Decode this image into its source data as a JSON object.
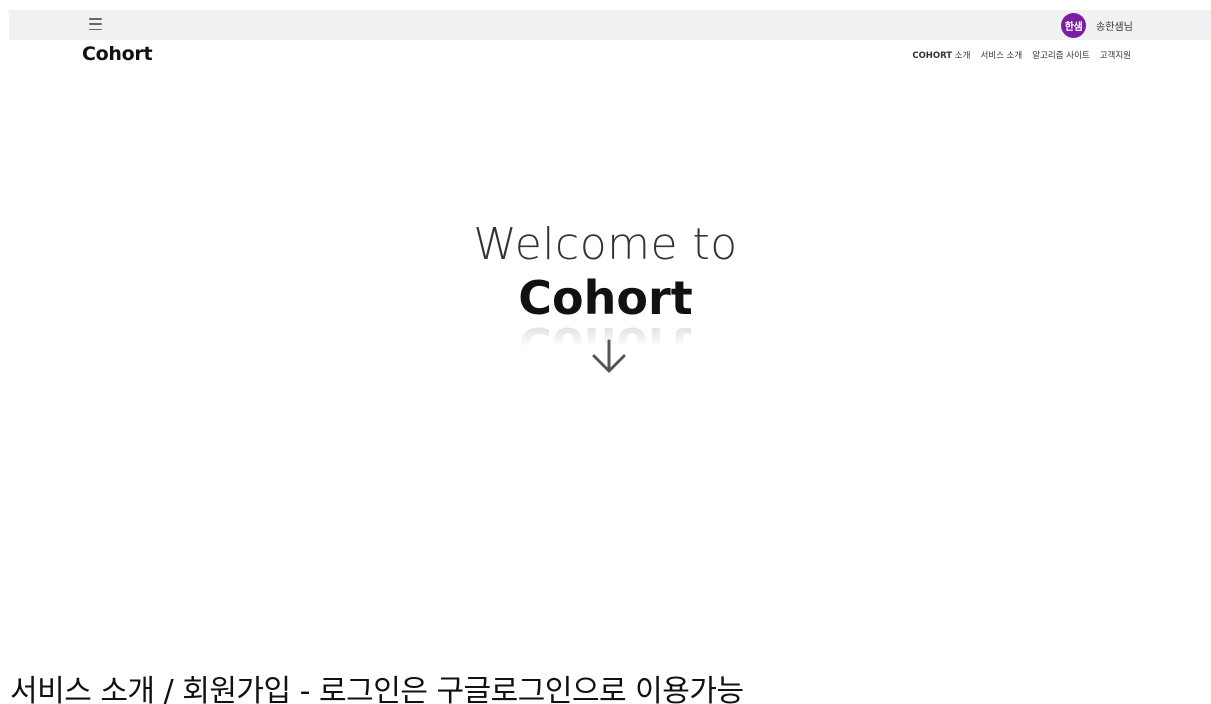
{
  "topbar": {
    "menu_icon": "hamburger-icon",
    "avatar_text": "한샘",
    "avatar_color": "#7b1fa2",
    "username": "송한샘님"
  },
  "header": {
    "brand": "Cohort",
    "nav": [
      {
        "strong": "COHORT",
        "rest": " 소개"
      },
      {
        "strong": "",
        "rest": "서비스 소개"
      },
      {
        "strong": "",
        "rest": "알고리즘 사이트"
      },
      {
        "strong": "",
        "rest": "고객지원"
      }
    ]
  },
  "hero": {
    "line1": "Welcome to",
    "line2": "Cohort",
    "scroll_icon": "arrow-down-icon"
  },
  "caption": "서비스 소개 / 회원가입 - 로그인은 구글로그인으로 이용가능"
}
